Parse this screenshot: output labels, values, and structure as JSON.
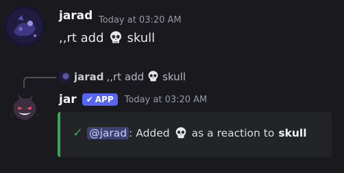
{
  "messages": [
    {
      "author": "jarad",
      "timestamp": "Today at 03:20 AM",
      "text_prefix": ",,rt add",
      "text_suffix": "skull"
    },
    {
      "reply": {
        "author": "jarad",
        "text_prefix": ",,rt add",
        "text_suffix": "skull"
      },
      "author": "jar",
      "badge": "APP",
      "timestamp": "Today at 03:20 AM",
      "embed": {
        "accent_color": "#3ba55c",
        "mention": "@jarad",
        "text_before": ": Added",
        "text_after": "as a reaction to",
        "target": "skull"
      }
    }
  ],
  "icons": {
    "skull": "skull-emoji",
    "check": "check-icon",
    "badge_check": "verified-check-icon"
  }
}
